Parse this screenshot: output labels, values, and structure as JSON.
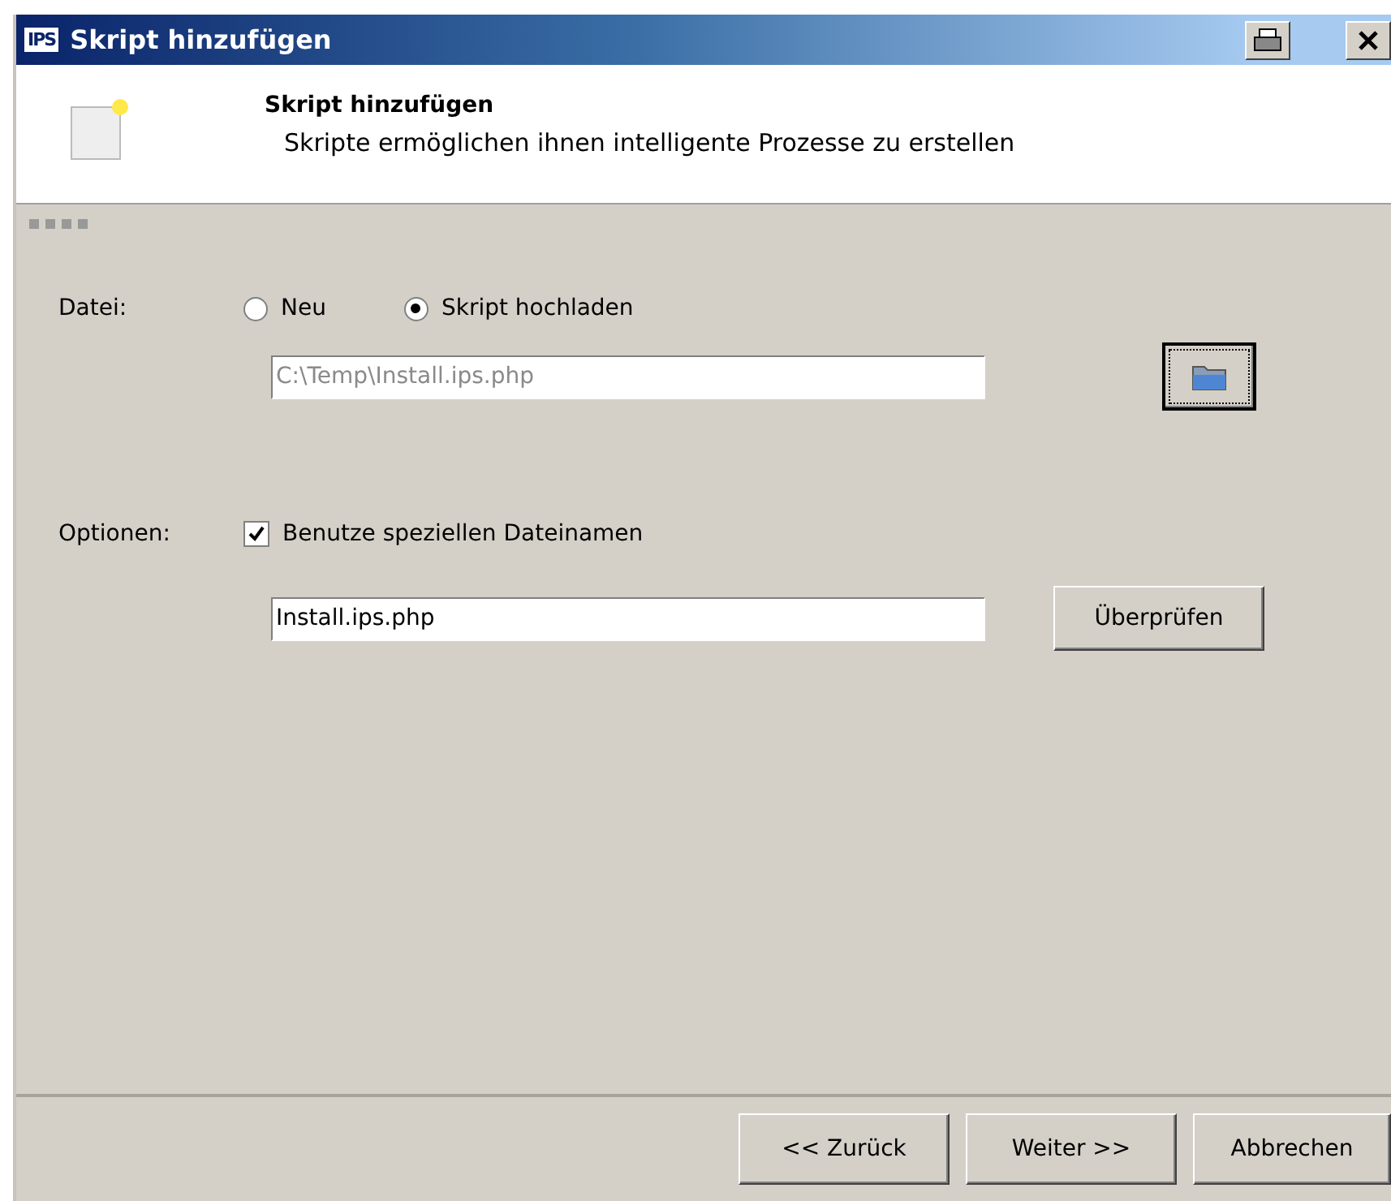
{
  "window": {
    "logo": "IPS",
    "title": "Skript hinzufügen"
  },
  "header": {
    "title": "Skript hinzufügen",
    "subtitle": "Skripte ermöglichen ihnen intelligente Prozesse zu erstellen"
  },
  "file": {
    "label": "Datei:",
    "options": [
      {
        "label": "Neu",
        "selected": false
      },
      {
        "label": "Skript hochladen",
        "selected": true
      }
    ],
    "path": {
      "value": "C:\\Temp\\Install.ips.php",
      "disabled": true
    }
  },
  "options": {
    "label": "Optionen:",
    "checkbox": {
      "label": "Benutze speziellen Dateinamen",
      "checked": true
    },
    "filename": {
      "value": "Install.ips.php",
      "disabled": false
    },
    "check_button": "Überprüfen"
  },
  "buttons": [
    "<< Zurück",
    "Weiter >>",
    "Abbrechen"
  ]
}
